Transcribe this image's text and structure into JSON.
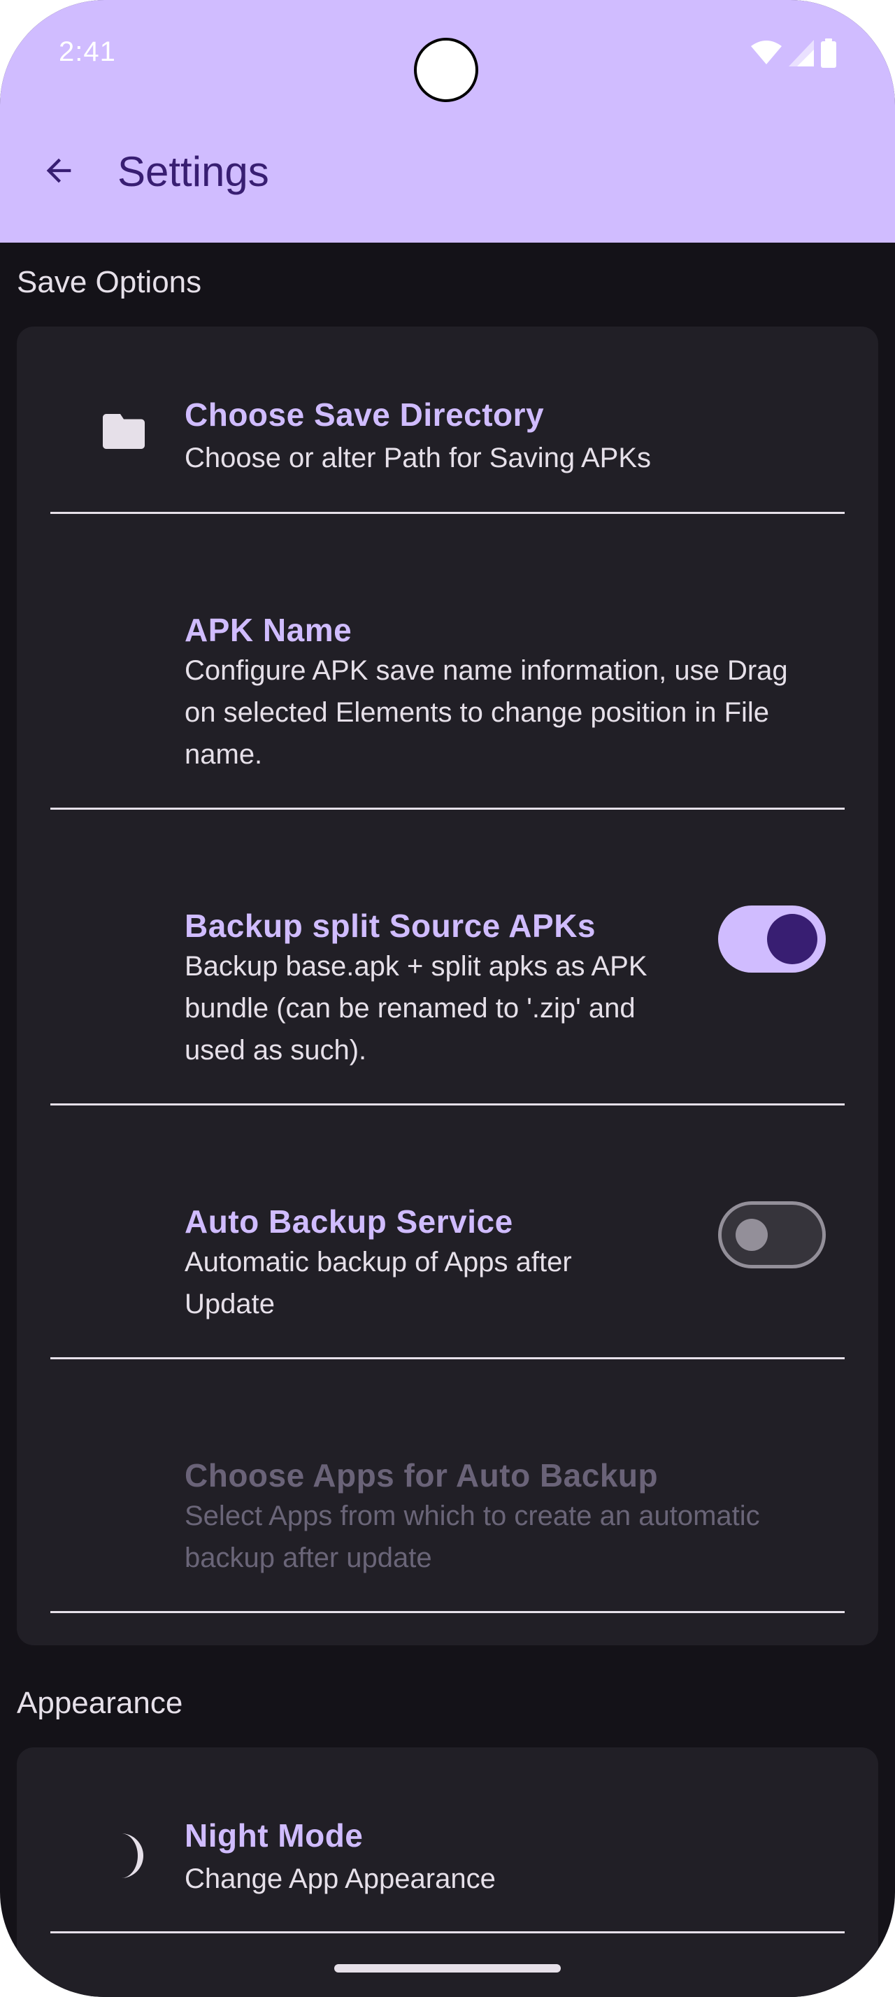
{
  "status_bar": {
    "time": "2:41",
    "icons": [
      "wifi-icon",
      "signal-icon",
      "battery-icon"
    ]
  },
  "app_bar": {
    "back_icon": "arrow-back-icon",
    "title": "Settings"
  },
  "sections": {
    "save_options": {
      "header": "Save Options",
      "choose_dir": {
        "icon": "folder-icon",
        "title": "Choose Save Directory",
        "summary": "Choose or alter Path for Saving APKs"
      },
      "apk_name": {
        "title": "APK Name",
        "summary_lines": [
          "Configure APK save name information, use Drag",
          "on selected Elements to change position in File",
          "name."
        ]
      },
      "split_apks": {
        "title": "Backup split Source APKs",
        "summary_lines": [
          "Backup base.apk + split apks as APK",
          "bundle (can be renamed to '.zip' and",
          "used as such)."
        ],
        "switch_on": true
      },
      "auto_backup": {
        "title": "Auto Backup Service",
        "summary_lines": [
          "Automatic backup of Apps after",
          "Update"
        ],
        "switch_on": false
      },
      "choose_apps": {
        "title": "Choose Apps for Auto Backup",
        "summary_lines": [
          "Select Apps from which to create an automatic",
          "backup after update"
        ],
        "enabled": false
      }
    },
    "appearance": {
      "header": "Appearance",
      "night_mode": {
        "icon": "moon-icon",
        "title": "Night Mode",
        "summary": "Change App Appearance"
      }
    }
  },
  "colors": {
    "app_bar_bg": "#d0bcff",
    "background": "#141218",
    "card": "#211f26",
    "accent": "#d0bcff",
    "on_primary": "#381e72",
    "text": "#e6e0e9"
  }
}
